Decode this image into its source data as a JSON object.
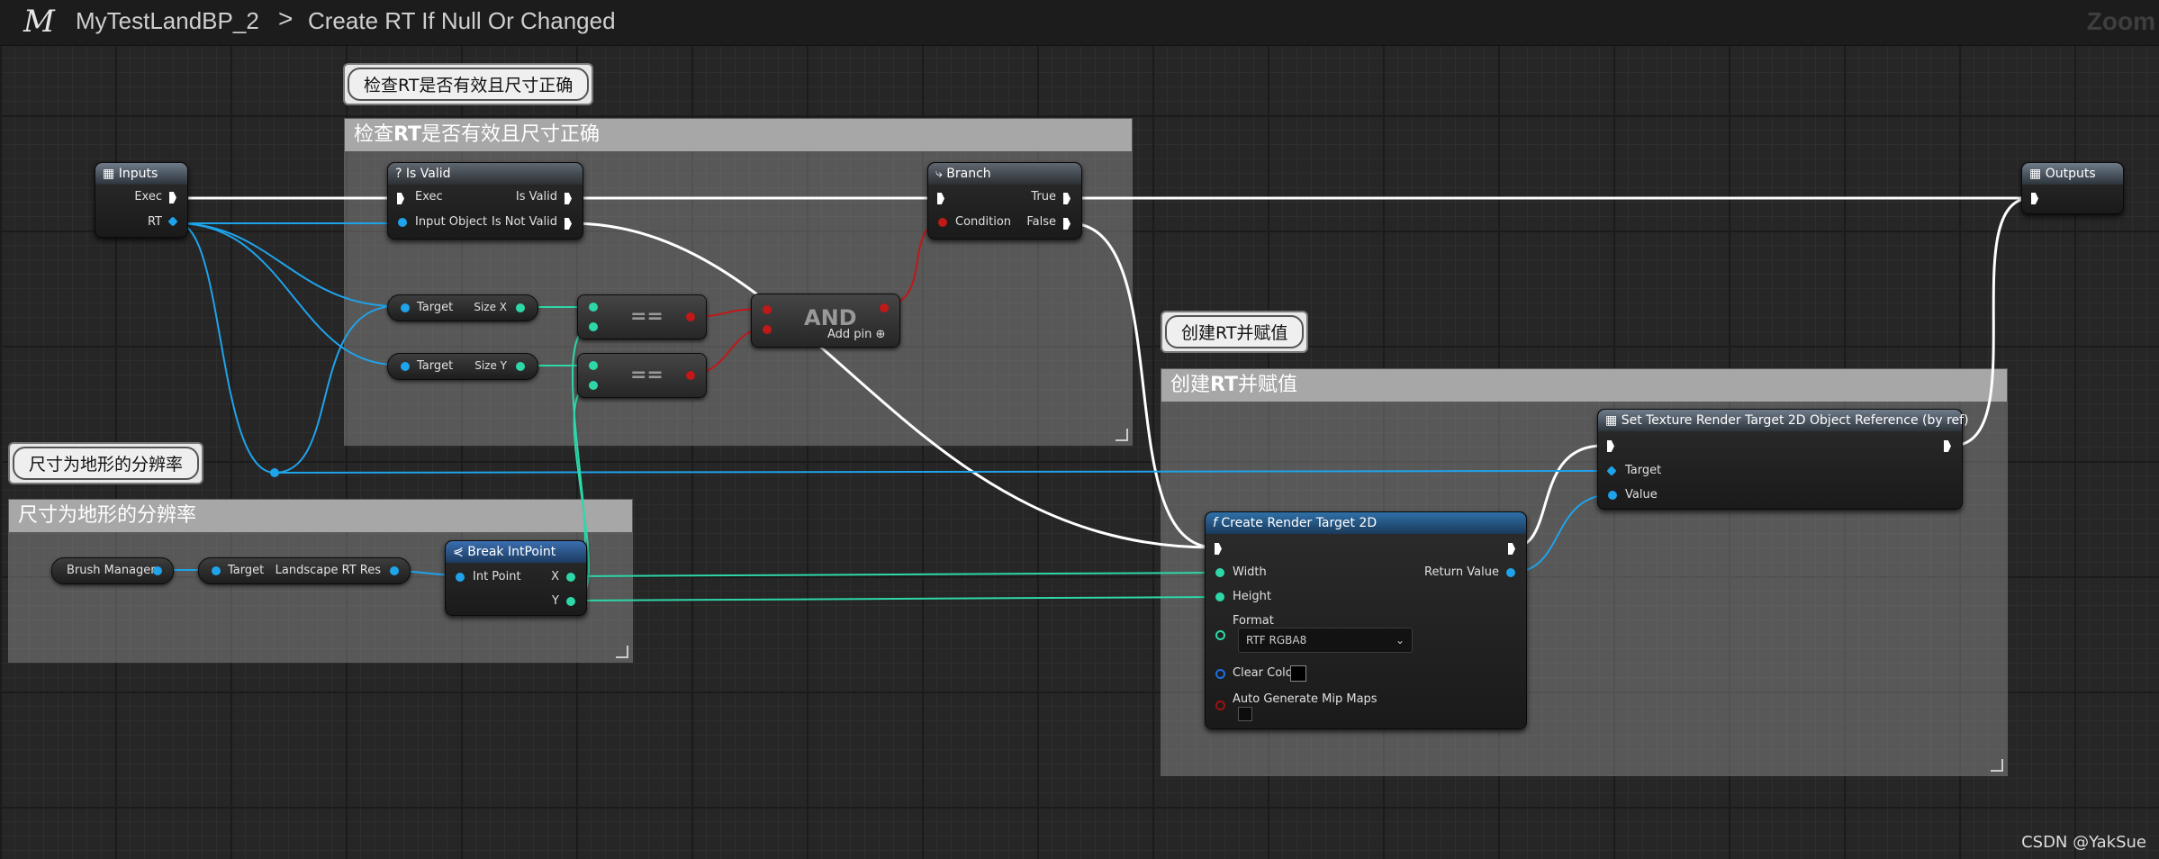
{
  "titlebar": {
    "logo": "M",
    "blueprint": "MyTestLandBP_2",
    "separator": ">",
    "function": "Create RT If Null Or Changed",
    "zoom_label": "Zoom"
  },
  "comments": {
    "check": {
      "bubble": "检查RT是否有效且尺寸正确",
      "header_pre": "检查",
      "header_bold": "RT",
      "header_post": "是否有效且尺寸正确"
    },
    "create": {
      "bubble": "创建RT并赋值",
      "header_pre": "创建",
      "header_bold": "RT",
      "header_post": "并赋值"
    },
    "resolution": {
      "bubble": "尺寸为地形的分辨率",
      "header": "尺寸为地形的分辨率"
    }
  },
  "nodes": {
    "inputs": {
      "title": "Inputs",
      "pins": [
        "Exec",
        "RT"
      ]
    },
    "outputs": {
      "title": "Outputs"
    },
    "is_valid": {
      "title": "Is Valid",
      "icon": "?",
      "in": [
        "Exec",
        "Input Object"
      ],
      "out": [
        "Is Valid",
        "Is Not Valid"
      ]
    },
    "branch": {
      "title": "Branch",
      "in": [
        "Condition"
      ],
      "out": [
        "True",
        "False"
      ]
    },
    "size_x": {
      "target": "Target",
      "out": "Size X"
    },
    "size_y": {
      "target": "Target",
      "out": "Size Y"
    },
    "eq1": {
      "op": "=="
    },
    "eq2": {
      "op": "=="
    },
    "and": {
      "op": "AND",
      "add_pin": "Add pin"
    },
    "brush_manager": {
      "label": "Brush Manager"
    },
    "landscape_res": {
      "target": "Target",
      "out": "Landscape RT Res"
    },
    "break_intpoint": {
      "title": "Break IntPoint",
      "in": "Int Point",
      "out": [
        "X",
        "Y"
      ]
    },
    "create_rt": {
      "title": "Create Render Target 2D",
      "icon": "f",
      "in": [
        "Width",
        "Height",
        "Format",
        "Clear Color",
        "Auto Generate Mip Maps"
      ],
      "out": "Return Value",
      "format_value": "RTF RGBA8"
    },
    "set_texture": {
      "title": "Set Texture Render Target 2D Object Reference (by ref)",
      "in": [
        "Target",
        "Value"
      ]
    }
  },
  "colors": {
    "exec": "#ffffff",
    "object": "#1fa3ea",
    "int": "#2ed7a8",
    "bool": "#c11818"
  },
  "watermark": "CSDN @YakSue"
}
